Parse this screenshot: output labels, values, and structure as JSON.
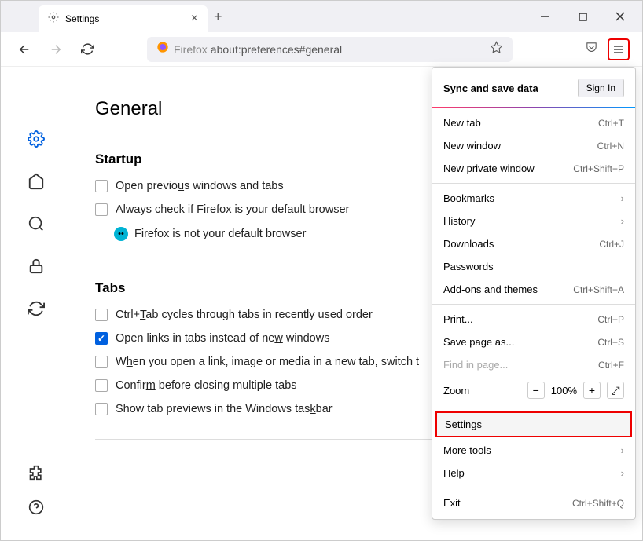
{
  "tab": {
    "title": "Settings"
  },
  "urlbar": {
    "prefix": "Firefox",
    "url": "about:preferences#general"
  },
  "page": {
    "title": "General"
  },
  "startup": {
    "title": "Startup",
    "open_previous": "Open previous windows and tabs",
    "always_check": "Always check if Firefox is your default browser",
    "not_default": "Firefox is not your default browser"
  },
  "tabs": {
    "title": "Tabs",
    "ctrl_tab": "Ctrl+Tab cycles through tabs in recently used order",
    "open_links": "Open links in tabs instead of new windows",
    "switch_to": "When you open a link, image or media in a new tab, switch t",
    "confirm_close": "Confirm before closing multiple tabs",
    "taskbar_preview": "Show tab previews in the Windows taskbar"
  },
  "menu": {
    "sync_title": "Sync and save data",
    "signin": "Sign In",
    "new_tab": {
      "label": "New tab",
      "shortcut": "Ctrl+T"
    },
    "new_window": {
      "label": "New window",
      "shortcut": "Ctrl+N"
    },
    "new_private": {
      "label": "New private window",
      "shortcut": "Ctrl+Shift+P"
    },
    "bookmarks": "Bookmarks",
    "history": "History",
    "downloads": {
      "label": "Downloads",
      "shortcut": "Ctrl+J"
    },
    "passwords": "Passwords",
    "addons": {
      "label": "Add-ons and themes",
      "shortcut": "Ctrl+Shift+A"
    },
    "print": {
      "label": "Print...",
      "shortcut": "Ctrl+P"
    },
    "save_as": {
      "label": "Save page as...",
      "shortcut": "Ctrl+S"
    },
    "find": {
      "label": "Find in page...",
      "shortcut": "Ctrl+F"
    },
    "zoom": {
      "label": "Zoom",
      "value": "100%"
    },
    "settings": "Settings",
    "more_tools": "More tools",
    "help": "Help",
    "exit": {
      "label": "Exit",
      "shortcut": "Ctrl+Shift+Q"
    }
  }
}
